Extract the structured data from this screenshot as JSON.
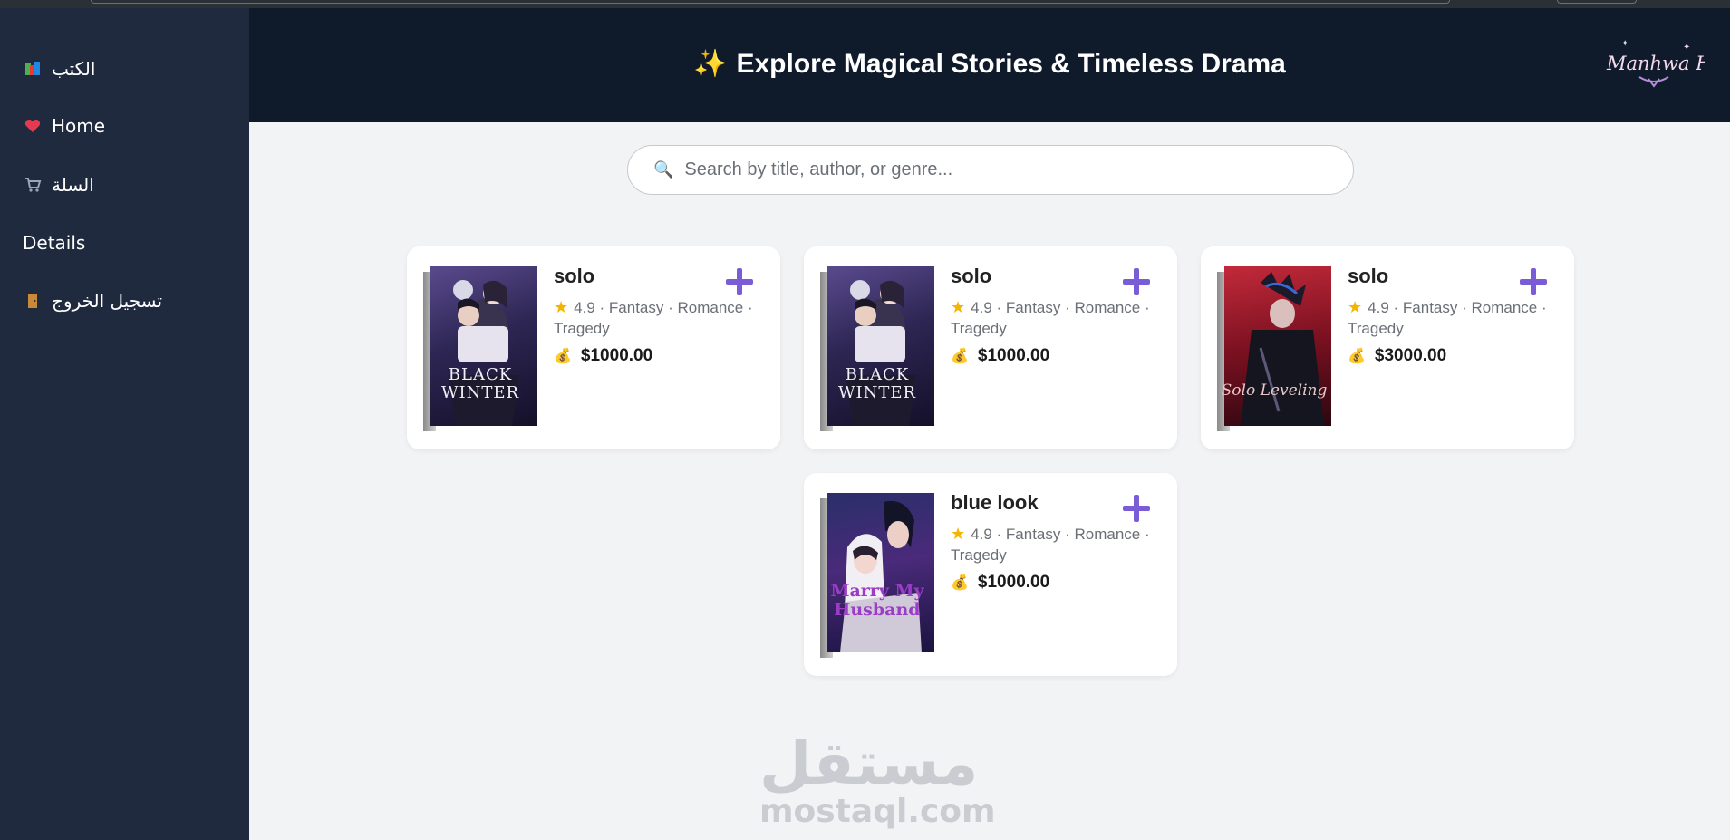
{
  "sidebar": {
    "items": [
      {
        "label": "الكتب",
        "icon": "books-icon"
      },
      {
        "label": "Home",
        "icon": "heart-icon"
      },
      {
        "label": "السلة",
        "icon": "cart-icon"
      },
      {
        "label": "Details",
        "icon": ""
      },
      {
        "label": "تسجيل الخروج",
        "icon": "door-icon"
      }
    ]
  },
  "header": {
    "title": "Explore Magical Stories & Timeless Drama",
    "title_icon": "sparkles-icon",
    "logo_text": "Manhwa Haven"
  },
  "search": {
    "placeholder": "Search by title, author, or genre...",
    "value": ""
  },
  "books": [
    {
      "title": "solo",
      "rating": "4.9",
      "genres": "· Fantasy · Romance · Tragedy",
      "price": "$1000.00",
      "cover_text": "BLACK WINTER"
    },
    {
      "title": "solo",
      "rating": "4.9",
      "genres": "· Fantasy · Romance · Tragedy",
      "price": "$1000.00",
      "cover_text": "BLACK WINTER"
    },
    {
      "title": "solo",
      "rating": "4.9",
      "genres": "· Fantasy · Romance · Tragedy",
      "price": "$3000.00",
      "cover_text": "Solo Leveling"
    },
    {
      "title": "blue look",
      "rating": "4.9",
      "genres": "· Fantasy · Romance · Tragedy",
      "price": "$1000.00",
      "cover_text": "Marry My Husband"
    }
  ],
  "watermark": {
    "arabic": "مستقل",
    "latin": "mostaql.com"
  },
  "colors": {
    "sidebar": "#1f2a3f",
    "header": "#0f1a2b",
    "accent": "#7a5cd6",
    "background": "#f2f3f5"
  }
}
